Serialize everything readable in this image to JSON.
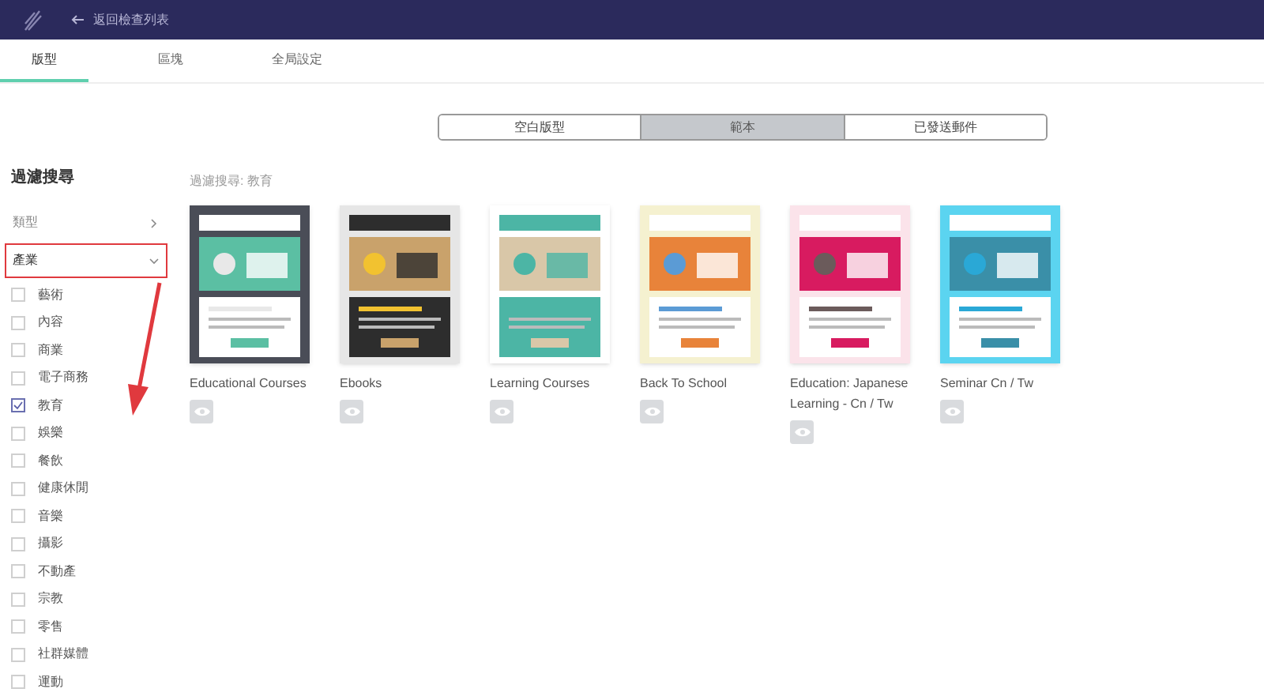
{
  "header": {
    "back_label": "返回檢查列表"
  },
  "tabs": [
    {
      "label": "版型",
      "selected": true
    },
    {
      "label": "區塊",
      "selected": false
    },
    {
      "label": "全局設定",
      "selected": false
    }
  ],
  "segments": [
    {
      "label": "空白版型",
      "selected": false
    },
    {
      "label": "範本",
      "selected": true
    },
    {
      "label": "已發送郵件",
      "selected": false
    }
  ],
  "filter": {
    "title": "過濾搜尋",
    "groups": [
      {
        "label": "類型",
        "expanded": false,
        "highlighted": false
      },
      {
        "label": "產業",
        "expanded": true,
        "highlighted": true
      }
    ],
    "options": [
      {
        "label": "藝術",
        "checked": false
      },
      {
        "label": "內容",
        "checked": false
      },
      {
        "label": "商業",
        "checked": false
      },
      {
        "label": "電子商務",
        "checked": false
      },
      {
        "label": "教育",
        "checked": true
      },
      {
        "label": "娛樂",
        "checked": false
      },
      {
        "label": "餐飲",
        "checked": false
      },
      {
        "label": "健康休閒",
        "checked": false
      },
      {
        "label": "音樂",
        "checked": false
      },
      {
        "label": "攝影",
        "checked": false
      },
      {
        "label": "不動產",
        "checked": false
      },
      {
        "label": "宗教",
        "checked": false
      },
      {
        "label": "零售",
        "checked": false
      },
      {
        "label": "社群媒體",
        "checked": false
      },
      {
        "label": "運動",
        "checked": false
      }
    ],
    "annotation_arrow": true
  },
  "results_label": "過濾搜尋: 教育",
  "templates": [
    {
      "name": "Educational Courses"
    },
    {
      "name": "Ebooks"
    },
    {
      "name": "Learning Courses"
    },
    {
      "name": "Back To School"
    },
    {
      "name": "Education: Japanese Learning - Cn / Tw"
    },
    {
      "name": "Seminar Cn / Tw"
    }
  ]
}
